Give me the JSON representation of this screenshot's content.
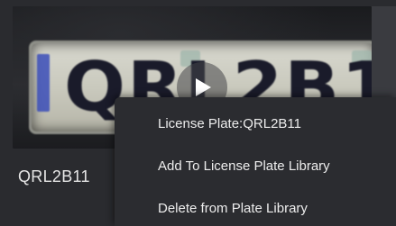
{
  "thumbnail": {
    "plate_text": "QRL2B11",
    "play_icon": "play-icon"
  },
  "card": {
    "plate_label": "QRL2B11"
  },
  "context_menu": {
    "items": [
      {
        "label": "License Plate:QRL2B11"
      },
      {
        "label": "Add To License Plate Library"
      },
      {
        "label": "Delete from Plate Library"
      }
    ]
  },
  "colors": {
    "background": "#1c1d20",
    "menu_background": "#2b2c30",
    "text": "#ededed"
  }
}
